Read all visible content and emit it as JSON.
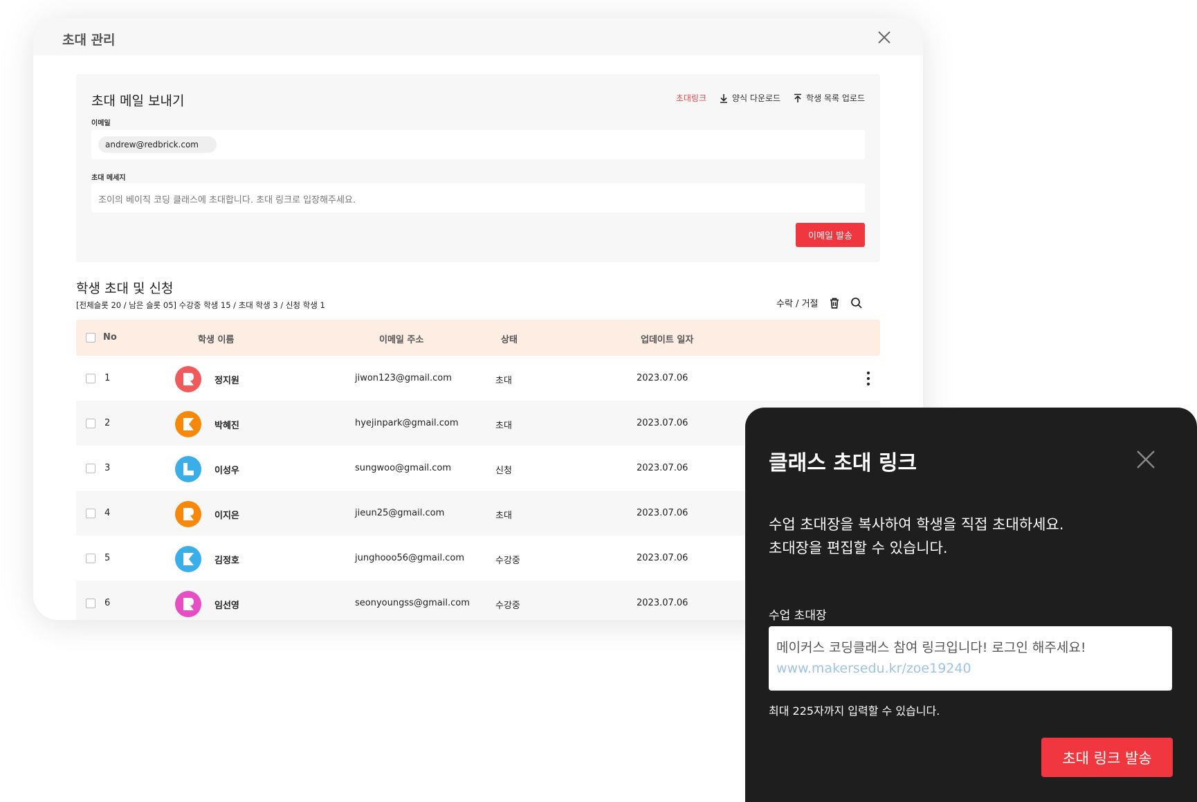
{
  "window": {
    "title": "초대 관리"
  },
  "mail": {
    "title": "초대 메일 보내기",
    "actions": {
      "invite_link": "초대링크",
      "download_form": "양식 다운로드",
      "upload_list": "학생 목록 업로드"
    },
    "email_label": "이메일",
    "email_chip": "andrew@redbrick.com",
    "message_label": "초대 메세지",
    "message_text": "조이의 베이직 코딩 클래스에 초대합니다. 초대 링크로 입장해주세요.",
    "send_button": "이메일 발송"
  },
  "students": {
    "title": "학생 초대 및 신청",
    "summary": "[전체슬롯 20 / 남은 슬롯 05] 수강중 학생 15 / 초대 학생 3 / 신청 학생 1",
    "accept_reject": "수락 / 거절",
    "headers": {
      "no": "No",
      "name": "학생 이름",
      "email": "이메일 주소",
      "status": "상태",
      "updated": "업데이트 일자"
    },
    "rows": [
      {
        "no": "1",
        "name": "정지원",
        "email": "jiwon123@gmail.com",
        "status": "초대",
        "updated": "2023.07.06",
        "avatar_color": "#f05a5a",
        "avatar_icon": "logo-r-icon"
      },
      {
        "no": "2",
        "name": "박혜진",
        "email": "hyejinpark@gmail.com",
        "status": "초대",
        "updated": "2023.07.06",
        "avatar_color": "#f7890a",
        "avatar_icon": "logo-k-icon"
      },
      {
        "no": "3",
        "name": "이성우",
        "email": "sungwoo@gmail.com",
        "status": "신청",
        "updated": "2023.07.06",
        "avatar_color": "#3aaee8",
        "avatar_icon": "logo-l-icon"
      },
      {
        "no": "4",
        "name": "이지은",
        "email": "jieun25@gmail.com",
        "status": "초대",
        "updated": "2023.07.06",
        "avatar_color": "#f7890a",
        "avatar_icon": "logo-r-icon"
      },
      {
        "no": "5",
        "name": "김정호",
        "email": "junghooo56@gmail.com",
        "status": "수강중",
        "updated": "2023.07.06",
        "avatar_color": "#3aaee8",
        "avatar_icon": "logo-k-icon"
      },
      {
        "no": "6",
        "name": "임선영",
        "email": "seonyoungss@gmail.com",
        "status": "수강중",
        "updated": "2023.07.06",
        "avatar_color": "#e64fc4",
        "avatar_icon": "logo-r-icon"
      }
    ]
  },
  "popup": {
    "title": "클래스 초대 링크",
    "description_line1": "수업 초대장을 복사하여 학생을 직접 초대하세요.",
    "description_line2": "초대장을 편집할 수 있습니다.",
    "field_label": "수업 초대장",
    "field_text": "메이커스 코딩클래스 참여 링크입니다! 로그인 해주세요!",
    "field_link": "www.makersedu.kr/zoe19240",
    "hint": "최대 225자까지 입력할 수 있습니다.",
    "send_button": "초대 링크 발송"
  },
  "colors": {
    "accent_red": "#f0363e",
    "header_peach": "#fdede3",
    "popup_bg": "#1e1e1e",
    "link_blue": "#9dc4e6"
  }
}
